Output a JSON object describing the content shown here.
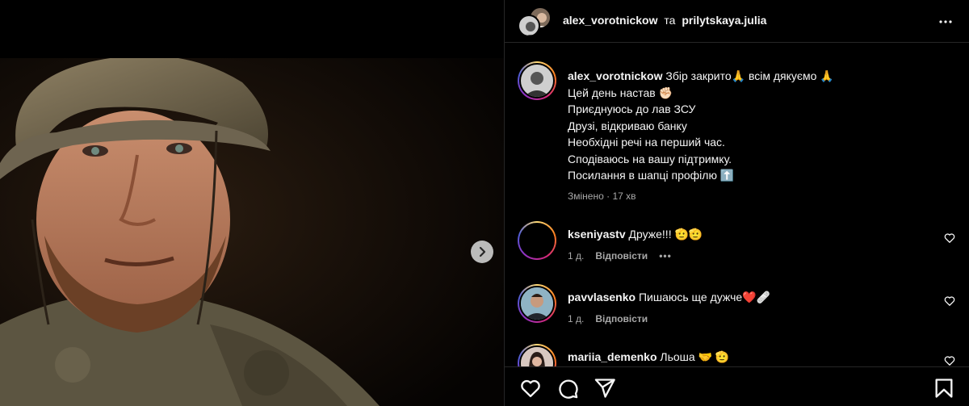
{
  "header": {
    "user1": "alex_vorotnickow",
    "joiner": "та",
    "user2": "prilytskaya.julia",
    "more_icon": "more-horizontal-icon"
  },
  "caption": {
    "username": "alex_vorotnickow",
    "line1": "Збір закрито🙏 всім дякуємо 🙏",
    "line2": "Цей день настав ✊🏻",
    "line3": "Приєднуюсь до лав ЗСУ",
    "line4": "Друзі, відкриваю банку",
    "line5": "Необхідні речі на перший час.",
    "line6": "Сподіваюсь на вашу підтримку.",
    "line7": "Посилання в шапці профілю ⬆️",
    "edited": "Змінено",
    "sep": "·",
    "time": "17 хв"
  },
  "comments": [
    {
      "username": "kseniyastv",
      "text": "Друже!!! 🫡🫡",
      "time": "1 д.",
      "reply": "Відповісти",
      "more": "•••"
    },
    {
      "username": "pavvlasenko",
      "text": "Пишаюсь ще дужче❤️🩹",
      "time": "1 д.",
      "reply": "Відповісти"
    },
    {
      "username": "mariia_demenko",
      "text": "Льоша 🤝 🫡"
    }
  ],
  "colors": {
    "accent": "#0095f6",
    "muted": "#a8a8a8",
    "border": "#262626"
  }
}
